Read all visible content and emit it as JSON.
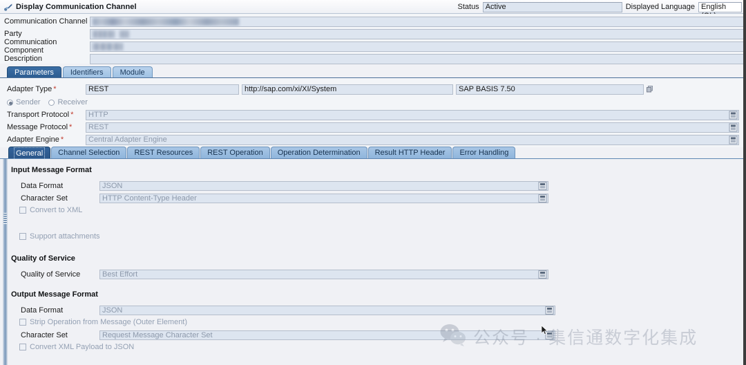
{
  "window": {
    "title": "Display Communication Channel",
    "icon": "channel-pencil-icon"
  },
  "header": {
    "status_label": "Status",
    "status_value": "Active",
    "language_label": "Displayed Language",
    "language_value": "English (OL)",
    "fields": [
      {
        "label": "Communication Channel",
        "value": "",
        "redacted": true
      },
      {
        "label": "Party",
        "value": "",
        "redacted": true
      },
      {
        "label": "Communication Component",
        "value": "",
        "redacted": true
      },
      {
        "label": "Description",
        "value": "",
        "redacted": false
      }
    ]
  },
  "main_tabs": [
    {
      "label": "Parameters",
      "active": true
    },
    {
      "label": "Identifiers",
      "active": false
    },
    {
      "label": "Module",
      "active": false
    }
  ],
  "parameters": {
    "adapter_type_label": "Adapter Type",
    "adapter_type_value": "REST",
    "adapter_namespace": "http://sap.com/xi/XI/System",
    "adapter_swcv": "SAP BASIS 7.50",
    "direction": {
      "sender_label": "Sender",
      "receiver_label": "Receiver",
      "selected": "Sender"
    },
    "rows": [
      {
        "label": "Transport Protocol",
        "value": "HTTP"
      },
      {
        "label": "Message Protocol",
        "value": "REST"
      },
      {
        "label": "Adapter Engine",
        "value": "Central Adapter Engine"
      }
    ]
  },
  "sub_tabs": [
    {
      "label": "General",
      "active": true
    },
    {
      "label": "Channel Selection",
      "active": false
    },
    {
      "label": "REST Resources",
      "active": false
    },
    {
      "label": "REST Operation",
      "active": false
    },
    {
      "label": "Operation Determination",
      "active": false
    },
    {
      "label": "Result HTTP Header",
      "active": false
    },
    {
      "label": "Error Handling",
      "active": false
    }
  ],
  "general": {
    "input_section_title": "Input Message Format",
    "input_data_format_label": "Data Format",
    "input_data_format_value": "JSON",
    "input_charset_label": "Character Set",
    "input_charset_value": "HTTP Content-Type Header",
    "convert_to_xml_label": "Convert to XML",
    "convert_to_xml_checked": false,
    "support_attachments_label": "Support attachments",
    "support_attachments_checked": false,
    "qos_section_title": "Quality of Service",
    "qos_label": "Quality of Service",
    "qos_value": "Best Effort",
    "output_section_title": "Output Message Format",
    "output_data_format_label": "Data Format",
    "output_data_format_value": "JSON",
    "strip_operation_label": "Strip Operation from Message (Outer Element)",
    "strip_operation_checked": false,
    "output_charset_label": "Character Set",
    "output_charset_value": "Request Message Character Set",
    "convert_xml_to_json_label": "Convert XML Payload to JSON",
    "convert_xml_to_json_checked": false
  },
  "watermark": {
    "text": "公众号 · 集信通数字化集成",
    "icon": "wechat-icon"
  },
  "colors": {
    "accent": "#2d5d92",
    "panel_bg": "#f0f1f5",
    "field_bg": "#dde5f0",
    "required_marker": "#c0392b"
  }
}
